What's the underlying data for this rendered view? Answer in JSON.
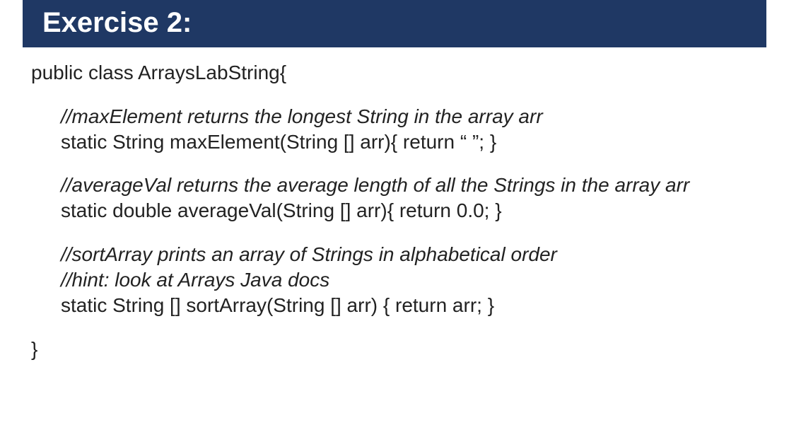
{
  "header": {
    "title": "Exercise 2:"
  },
  "code": {
    "class_decl": "public class ArraysLabString{",
    "block1": {
      "comment": "//maxElement returns the longest String in the array arr",
      "line": "static String maxElement(String [] arr){ return “ ”; }"
    },
    "block2": {
      "comment": "//averageVal returns the average length of all the Strings in the array arr",
      "line": "static double averageVal(String [] arr){ return 0.0; }"
    },
    "block3": {
      "comment1": "//sortArray prints an array of Strings in alphabetical order",
      "comment2": "//hint: look at Arrays Java docs",
      "line": "static String [] sortArray(String [] arr) { return arr; }"
    },
    "close": "}"
  }
}
